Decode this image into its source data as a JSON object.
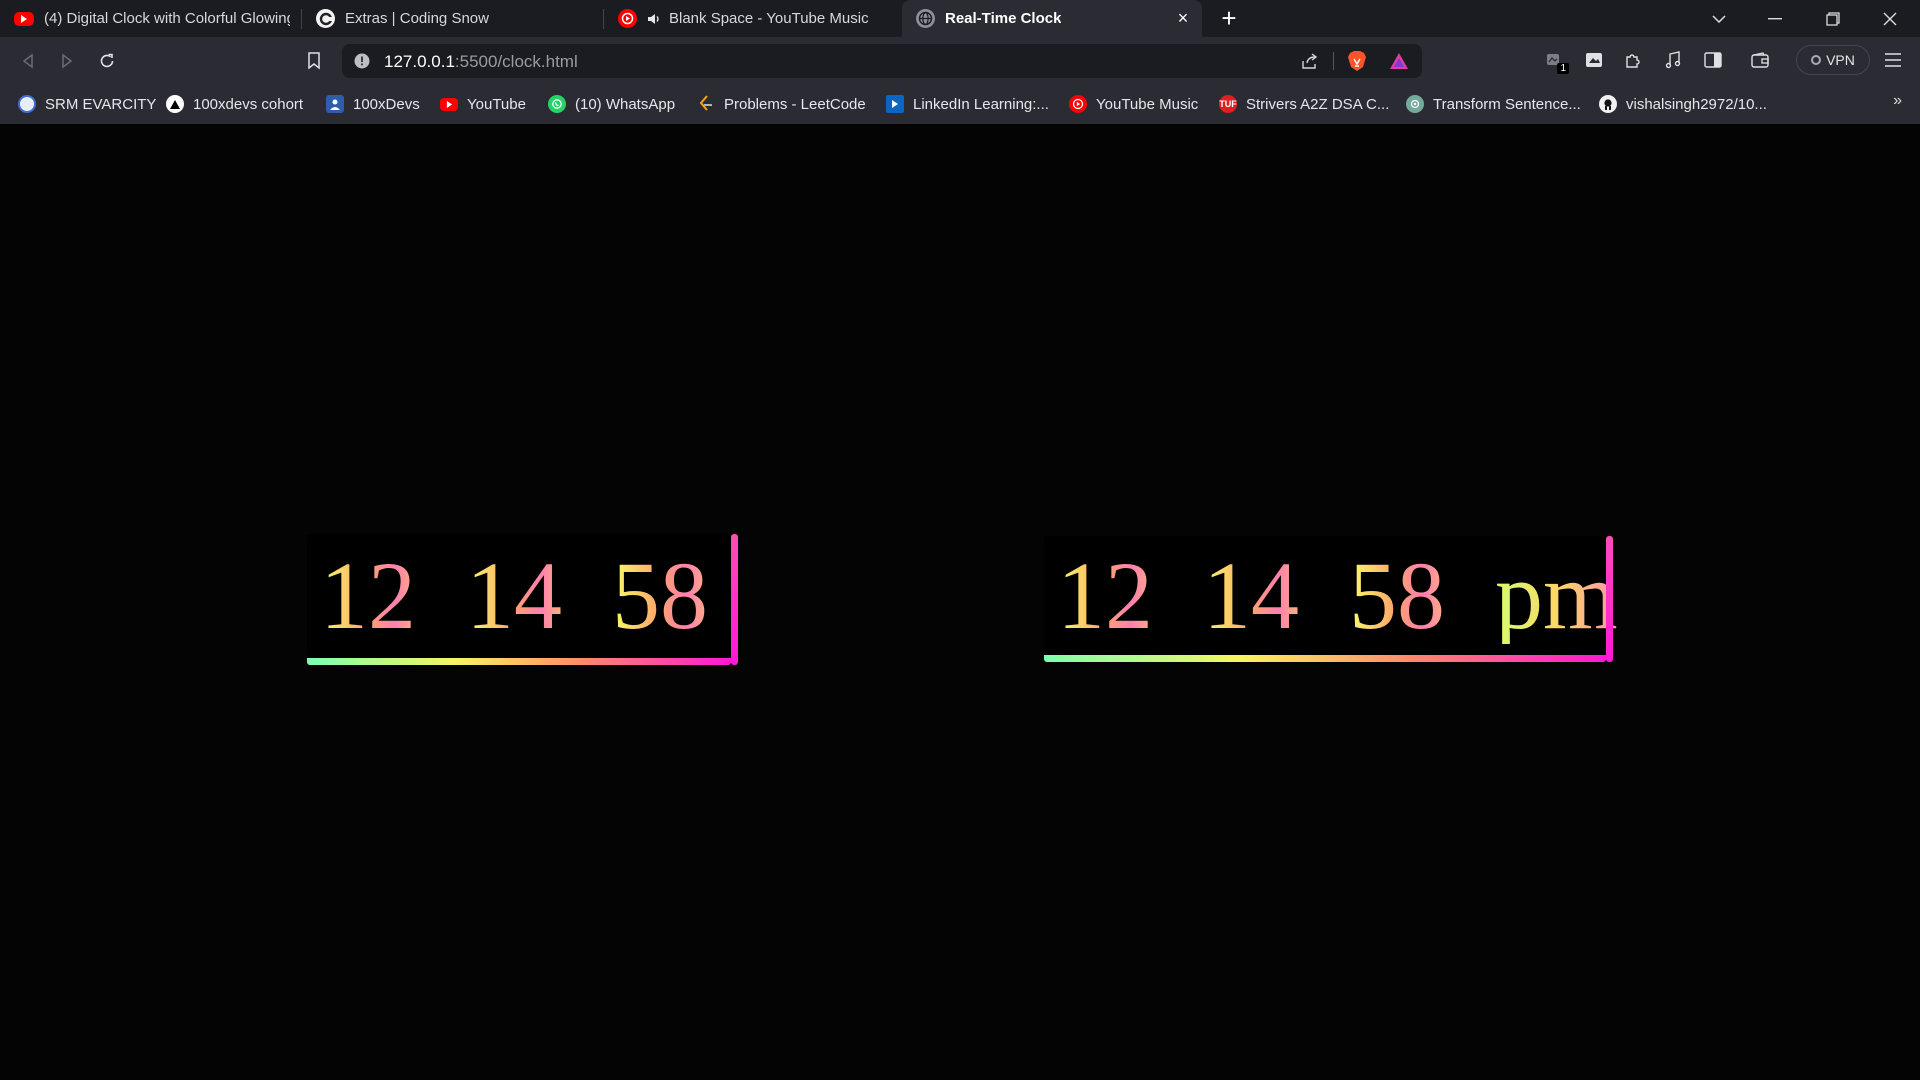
{
  "tabs": [
    {
      "title": "(4) Digital Clock with Colorful Glowing",
      "icon": "youtube-icon"
    },
    {
      "title": "Extras | Coding Snow",
      "icon": "coding-snow-icon"
    },
    {
      "title": "Blank Space - YouTube Music",
      "icon": "youtube-music-icon",
      "audio": true
    },
    {
      "title": "Real-Time Clock",
      "icon": "globe-icon",
      "active": true
    }
  ],
  "address_bar": {
    "host": "127.0.0.1",
    "path": ":5500/clock.html"
  },
  "toolbar": {
    "vpn_label": "VPN",
    "extension_badge": "1"
  },
  "bookmarks": [
    {
      "label": "SRM EVARCITY",
      "icon": "srm-icon"
    },
    {
      "label": "100xdevs cohort",
      "icon": "triangle-icon"
    },
    {
      "label": "100xDevs",
      "icon": "avatar-icon"
    },
    {
      "label": "YouTube",
      "icon": "youtube-icon"
    },
    {
      "label": "(10) WhatsApp",
      "icon": "whatsapp-icon"
    },
    {
      "label": "Problems - LeetCode",
      "icon": "leetcode-icon"
    },
    {
      "label": "LinkedIn Learning:...",
      "icon": "linkedin-learning-icon"
    },
    {
      "label": "YouTube Music",
      "icon": "youtube-music-icon"
    },
    {
      "label": "Strivers A2Z DSA C...",
      "icon": "tuf-icon",
      "icon_text": "TUF"
    },
    {
      "label": "Transform Sentence...",
      "icon": "chatgpt-icon"
    },
    {
      "label": "vishalsingh2972/10...",
      "icon": "github-icon"
    }
  ],
  "clock_left": {
    "hours": "12",
    "minutes": "14",
    "seconds": "58"
  },
  "clock_right": {
    "hours": "12",
    "minutes": "14",
    "seconds": "58",
    "ampm": "pm"
  },
  "colors": {
    "glow_gradient": [
      "#7dffb0",
      "#f7f560",
      "#ff8a6a",
      "#ff18d6"
    ],
    "brave_orange": "#fb542b",
    "youtube_red": "#ff0000"
  }
}
